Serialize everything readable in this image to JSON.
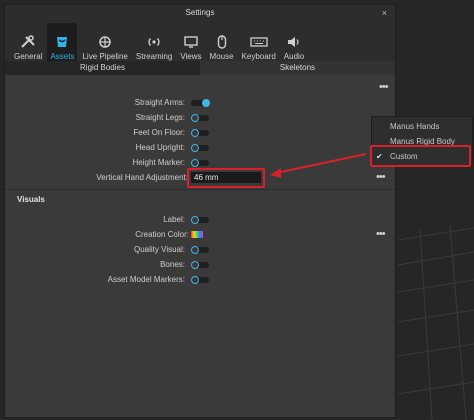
{
  "window": {
    "title": "Settings",
    "close_glyph": "×"
  },
  "toolbar": [
    {
      "label": "General",
      "icon": "tools-icon"
    },
    {
      "label": "Assets",
      "icon": "assets-icon",
      "active": true
    },
    {
      "label": "Live Pipeline",
      "icon": "pipeline-icon"
    },
    {
      "label": "Streaming",
      "icon": "streaming-icon"
    },
    {
      "label": "Views",
      "icon": "monitor-icon"
    },
    {
      "label": "Mouse",
      "icon": "mouse-icon"
    },
    {
      "label": "Keyboard",
      "icon": "keyboard-icon"
    },
    {
      "label": "Audio",
      "icon": "audio-icon"
    }
  ],
  "tabs": [
    {
      "label": "Rigid Bodies"
    },
    {
      "label": "Skeletons",
      "selected": true
    }
  ],
  "skeleton_settings": {
    "straight_arms": {
      "label": "Straight Arms:",
      "on": true
    },
    "straight_legs": {
      "label": "Straight Legs:",
      "on": false
    },
    "feet_on_floor": {
      "label": "Feet On Floor:",
      "on": false
    },
    "head_upright": {
      "label": "Head Upright:",
      "on": false
    },
    "height_marker": {
      "label": "Height Marker:",
      "on": false
    },
    "vertical_hand_adjustment": {
      "label": "Vertical Hand Adjustment:",
      "value": "46 mm"
    }
  },
  "dropdown": {
    "items": [
      "Manus Hands",
      "Manus Rigid Body",
      "Custom"
    ],
    "selected": "Custom",
    "check_glyph": "✔"
  },
  "visuals": {
    "title": "Visuals",
    "label": {
      "label": "Label:",
      "on": false
    },
    "creation_color": {
      "label": "Creation Color:"
    },
    "quality_visual": {
      "label": "Quality Visual:",
      "on": false
    },
    "bones": {
      "label": "Bones:",
      "on": false
    },
    "asset_model_markers": {
      "label": "Asset Model Markers:",
      "on": false
    }
  },
  "more_glyph": "•••",
  "colors": {
    "accent": "#2fb4e9",
    "highlight": "#d9212a"
  }
}
